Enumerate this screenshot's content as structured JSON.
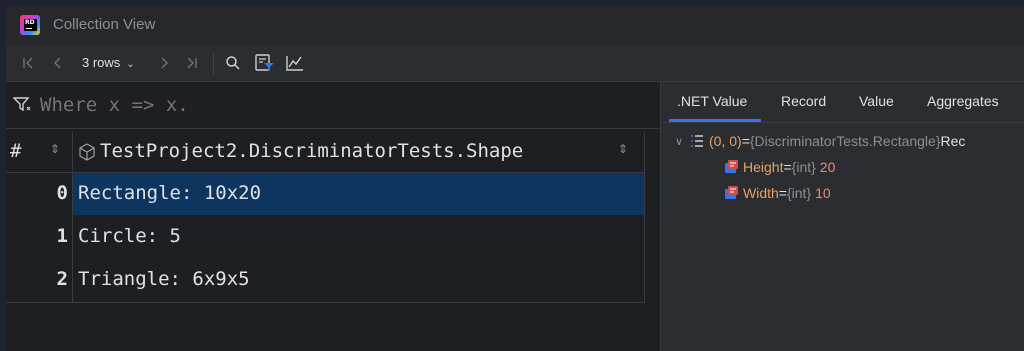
{
  "window": {
    "title": "Collection View",
    "logo_text": "RD"
  },
  "toolbar": {
    "rows_label": "3 rows",
    "buttons": [
      "first-page",
      "previous-page",
      "next-page",
      "last-page",
      "search",
      "filter-view",
      "chart"
    ]
  },
  "filter": {
    "placeholder": "Where x => x."
  },
  "grid": {
    "index_header": "#",
    "column_header": "TestProject2.DiscriminatorTests.Shape",
    "rows": [
      {
        "index": "0",
        "value": "Rectangle: 10x20",
        "selected": true
      },
      {
        "index": "1",
        "value": "Circle: 5",
        "selected": false
      },
      {
        "index": "2",
        "value": "Triangle: 6x9x5",
        "selected": false
      }
    ]
  },
  "details": {
    "tabs": [
      ".NET Value",
      "Record",
      "Value",
      "Aggregates"
    ],
    "active_tab": ".NET Value",
    "tree": {
      "root": {
        "name": "(0, 0)",
        "eq": " = ",
        "type": "{DiscriminatorTests.Rectangle}",
        "suffix": " Rec"
      },
      "children": [
        {
          "name": "Height",
          "eq": " = ",
          "type": "{int}",
          "value": "20"
        },
        {
          "name": "Width",
          "eq": " = ",
          "type": "{int}",
          "value": "10"
        }
      ]
    }
  },
  "colors": {
    "selection": "#0d355d",
    "accent": "#3574f0",
    "field_name": "#e8a16a",
    "number_value": "#f08686"
  }
}
